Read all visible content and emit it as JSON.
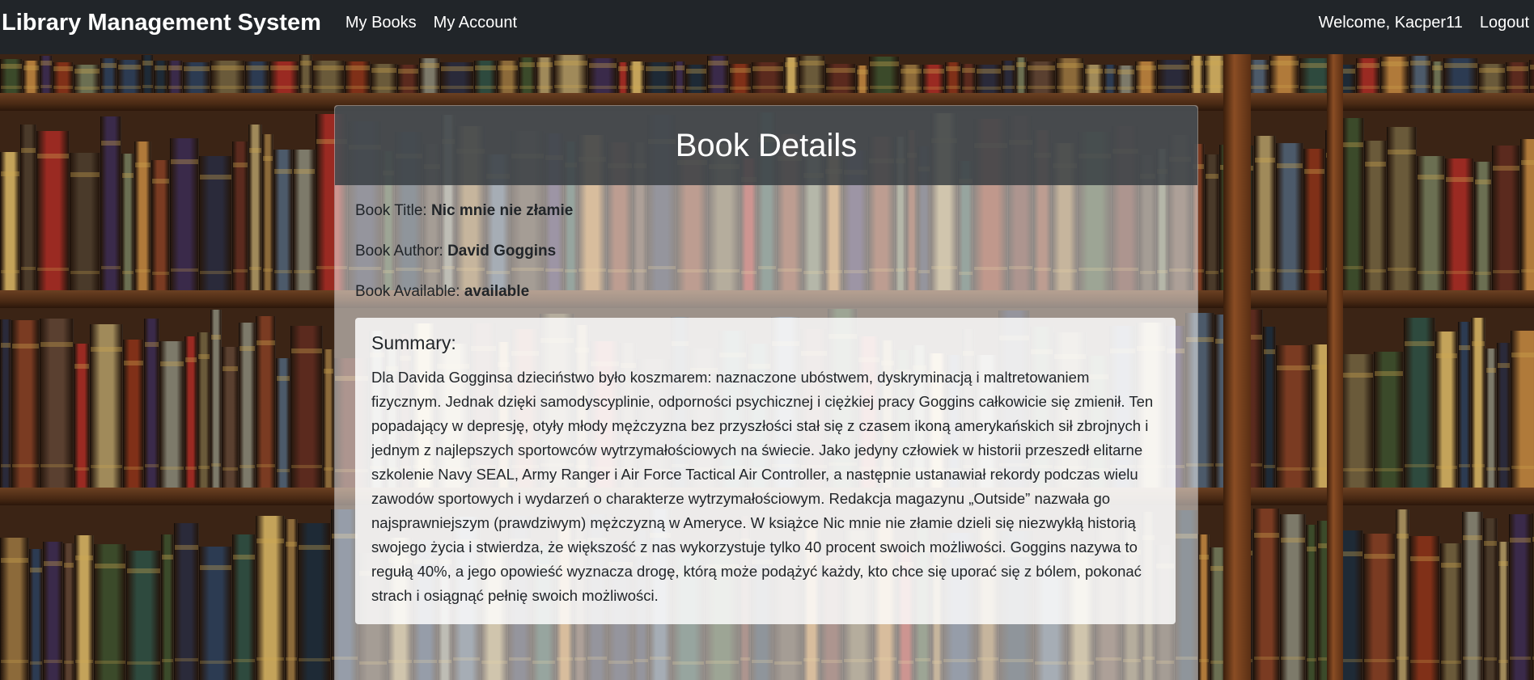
{
  "navbar": {
    "brand": "Library Management System",
    "links": [
      "My Books",
      "My Account"
    ],
    "welcome": "Welcome, Kacper11",
    "logout": "Logout"
  },
  "card": {
    "title": "Book Details",
    "details": [
      {
        "label": "Book Title: ",
        "value": "Nic mnie nie złamie"
      },
      {
        "label": "Book Author: ",
        "value": "David Goggins"
      },
      {
        "label": "Book Available: ",
        "value": "available"
      }
    ],
    "summary": {
      "heading": "Summary:",
      "text": "Dla Davida Gogginsa dzieciństwo było koszmarem: naznaczone ubóstwem, dyskryminacją i maltretowaniem fizycznym. Jednak dzięki samodyscyplinie, odporności psychicznej i ciężkiej pracy Goggins całkowicie się zmienił. Ten popadający w depresję, otyły młody mężczyzna bez przyszłości stał się z czasem ikoną amerykańskich sił zbrojnych i jednym z najlepszych sportowców wytrzymałościowych na świecie. Jako jedyny człowiek w historii przeszedł elitarne szkolenie Navy SEAL, Army Ranger i Air Force Tactical Air Controller, a następnie ustanawiał rekordy podczas wielu zawodów sportowych i wydarzeń o charakterze wytrzymałościowym. Redakcja magazynu „Outside” nazwała go najsprawniejszym (prawdziwym) mężczyzną w Ameryce. W książce Nic mnie nie złamie dzieli się niezwykłą historią swojego życia i stwierdza, że większość z nas wykorzystuje tylko 40 procent swoich możliwości. Goggins nazywa to regułą 40%, a jego opowieść wyznacza drogę, którą może podążyć każdy, kto chce się uporać się z bólem, pokonać strach i osiągnąć pełnię swoich możliwości."
    }
  },
  "colors": {
    "navbar_bg": "#212529",
    "card_header_bg": "#343a40",
    "text": "#212529"
  }
}
